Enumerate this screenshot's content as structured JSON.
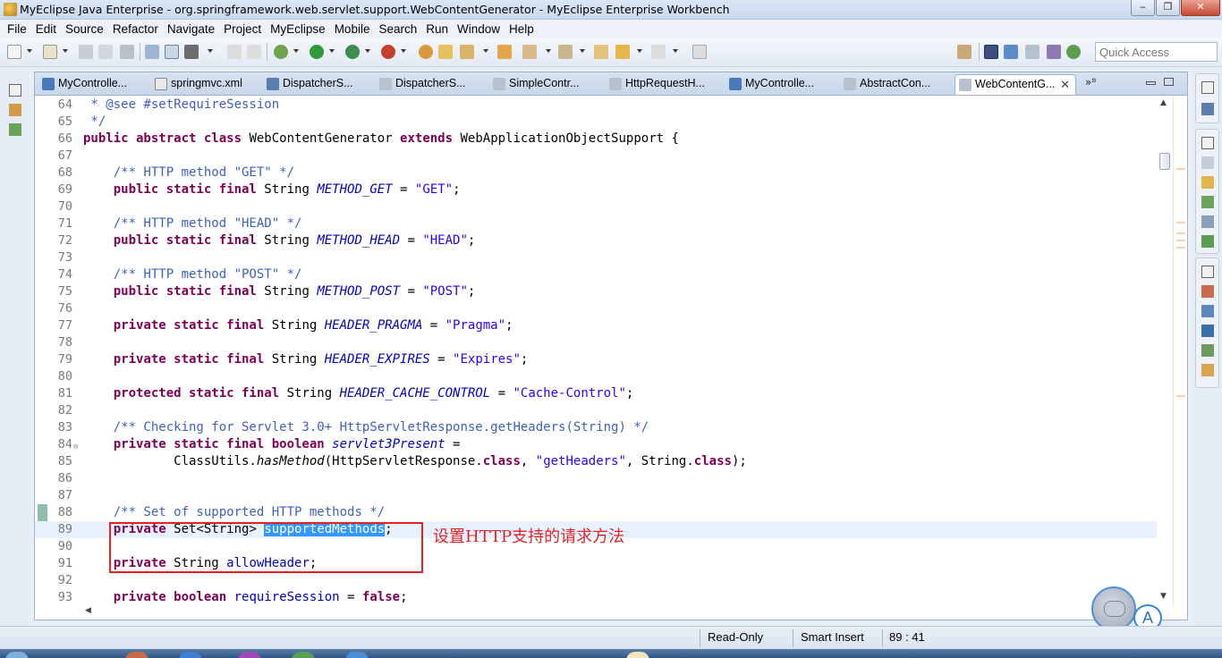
{
  "window": {
    "title": "MyEclipse Java Enterprise - org.springframework.web.servlet.support.WebContentGenerator - MyEclipse Enterprise Workbench",
    "min_glyph": "‒",
    "max_glyph": "❐",
    "close_glyph": "✕"
  },
  "menu": [
    "File",
    "Edit",
    "Source",
    "Refactor",
    "Navigate",
    "Project",
    "MyEclipse",
    "Mobile",
    "Search",
    "Run",
    "Window",
    "Help"
  ],
  "toolbar": {
    "quick_access_placeholder": "Quick Access"
  },
  "tabs": [
    {
      "label": "MyControlle...",
      "icon": "java-class-icon",
      "active": false
    },
    {
      "label": "springmvc.xml",
      "icon": "xml-file-icon",
      "active": false
    },
    {
      "label": "DispatcherS...",
      "icon": "class-file-icon",
      "active": false
    },
    {
      "label": "DispatcherS...",
      "icon": "binary-class-icon",
      "active": false
    },
    {
      "label": "SimpleContr...",
      "icon": "binary-class-icon",
      "active": false
    },
    {
      "label": "HttpRequestH...",
      "icon": "binary-class-icon",
      "active": false
    },
    {
      "label": "MyControlle...",
      "icon": "java-class-icon",
      "active": false
    },
    {
      "label": "AbstractCon...",
      "icon": "binary-class-icon",
      "active": false
    },
    {
      "label": "WebContentG...",
      "icon": "binary-class-icon",
      "active": true,
      "close": "✕"
    }
  ],
  "tab_overflow": "»⁸",
  "code": {
    "lines": [
      {
        "n": "64",
        "html": "<span class='cm'> * @see #setRequireSession</span>"
      },
      {
        "n": "65",
        "html": "<span class='cm'> */</span>"
      },
      {
        "n": "66",
        "html": "<span class='kw'>public abstract class</span> WebContentGenerator <span class='kw'>extends</span> WebApplicationObjectSupport {"
      },
      {
        "n": "67",
        "html": ""
      },
      {
        "n": "68",
        "html": "    <span class='cm'>/** HTTP method \"GET\" */</span>"
      },
      {
        "n": "69",
        "html": "    <span class='kw'>public static final</span> String <span class='sf'>METHOD_GET</span> = <span class='st'>\"GET\"</span>;"
      },
      {
        "n": "70",
        "html": ""
      },
      {
        "n": "71",
        "html": "    <span class='cm'>/** HTTP method \"HEAD\" */</span>"
      },
      {
        "n": "72",
        "html": "    <span class='kw'>public static final</span> String <span class='sf'>METHOD_HEAD</span> = <span class='st'>\"HEAD\"</span>;"
      },
      {
        "n": "73",
        "html": ""
      },
      {
        "n": "74",
        "html": "    <span class='cm'>/** HTTP method \"POST\" */</span>"
      },
      {
        "n": "75",
        "html": "    <span class='kw'>public static final</span> String <span class='sf'>METHOD_POST</span> = <span class='st'>\"POST\"</span>;"
      },
      {
        "n": "76",
        "html": ""
      },
      {
        "n": "77",
        "html": "    <span class='kw'>private static final</span> String <span class='sf'>HEADER_PRAGMA</span> = <span class='st'>\"Pragma\"</span>;"
      },
      {
        "n": "78",
        "html": ""
      },
      {
        "n": "79",
        "html": "    <span class='kw'>private static final</span> String <span class='sf'>HEADER_EXPIRES</span> = <span class='st'>\"Expires\"</span>;"
      },
      {
        "n": "80",
        "html": ""
      },
      {
        "n": "81",
        "html": "    <span class='kw'>protected static final</span> String <span class='sf'>HEADER_CACHE_CONTROL</span> = <span class='st'>\"Cache-Control\"</span>;"
      },
      {
        "n": "82",
        "html": ""
      },
      {
        "n": "83",
        "html": "    <span class='cm'>/** Checking for Servlet 3.0+ HttpServletResponse.getHeaders(String) */</span>"
      },
      {
        "n": "84",
        "html": "    <span class='kw'>private static final boolean</span> <span class='sf'>servlet3Present</span> =",
        "fold": "⊖"
      },
      {
        "n": "85",
        "html": "            ClassUtils.<span class='it'>hasMethod</span>(HttpServletResponse.<span class='kw'>class</span>, <span class='st'>\"getHeaders\"</span>, String.<span class='kw'>class</span>);"
      },
      {
        "n": "86",
        "html": ""
      },
      {
        "n": "87",
        "html": ""
      },
      {
        "n": "88",
        "html": "    <span class='cm'>/** Set of supported HTTP methods */</span>"
      },
      {
        "n": "89",
        "html": "    <span class='kw'>private</span> Set&lt;String&gt; <span class='sel'>supportedMethods</span>;",
        "current": true
      },
      {
        "n": "90",
        "html": ""
      },
      {
        "n": "91",
        "html": "    <span class='kw'>private</span> String <span class='fd'>allowHeader</span>;"
      },
      {
        "n": "92",
        "html": ""
      },
      {
        "n": "93",
        "html": "    <span class='kw'>private boolean</span> <span class='fd'>requireSession</span> = <span class='kw'>false</span>;"
      }
    ]
  },
  "annotation": {
    "text": "设置HTTP支持的请求方法",
    "color": "#e52222"
  },
  "status": {
    "read_only": "Read-Only",
    "insert_mode": "Smart Insert",
    "position": "89 : 41"
  },
  "assistant_badge": "A"
}
